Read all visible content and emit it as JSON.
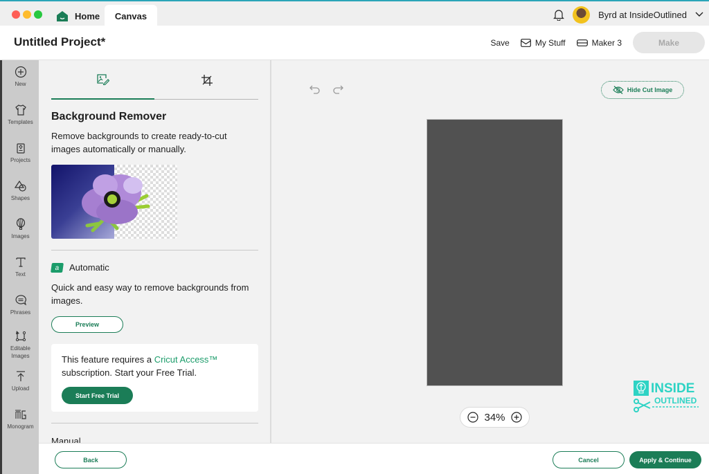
{
  "window": {
    "tabs": [
      {
        "label": "Home",
        "icon": "home-icon"
      },
      {
        "label": "Canvas",
        "active": true
      }
    ],
    "user": {
      "name": "Byrd at InsideOutlined",
      "avatar": "avatar",
      "notification_icon": "bell-icon"
    }
  },
  "header": {
    "project_title": "Untitled Project*",
    "save_label": "Save",
    "my_stuff_label": "My Stuff",
    "machine_label": "Maker 3",
    "make_label": "Make"
  },
  "sidebar": {
    "items": [
      {
        "label": "New",
        "icon": "plus-circle-icon"
      },
      {
        "label": "Templates",
        "icon": "shirt-icon"
      },
      {
        "label": "Projects",
        "icon": "projects-icon"
      },
      {
        "label": "Shapes",
        "icon": "shapes-icon"
      },
      {
        "label": "Images",
        "icon": "balloon-icon"
      },
      {
        "label": "Text",
        "icon": "text-icon"
      },
      {
        "label": "Phrases",
        "icon": "speech-bubble-icon"
      },
      {
        "label": "Editable Images",
        "icon": "editable-images-icon"
      },
      {
        "label": "Upload",
        "icon": "upload-icon"
      },
      {
        "label": "Monogram",
        "icon": "monogram-icon"
      }
    ]
  },
  "panel": {
    "tabs": [
      {
        "name": "background-remover",
        "icon": "image-edit-icon",
        "active": true
      },
      {
        "name": "crop",
        "icon": "crop-icon",
        "active": false
      }
    ],
    "title": "Background Remover",
    "description": "Remove backgrounds to create ready-to-cut images automatically or manually.",
    "automatic": {
      "label": "Automatic",
      "badge": "a",
      "description": "Quick and easy way to remove backgrounds from images.",
      "preview_label": "Preview"
    },
    "access": {
      "text_before": "This feature requires a ",
      "link": "Cricut Access™",
      "text_after": " subscription. Start your Free Trial.",
      "trial_label": "Start Free Trial"
    },
    "manual_label": "Manual"
  },
  "canvas": {
    "hide_cut_label": "Hide Cut Image",
    "zoom_level": "34%",
    "watermark": {
      "line1": "INSIDE",
      "line2": "OUTLINED"
    }
  },
  "footer": {
    "back_label": "Back",
    "cancel_label": "Cancel",
    "apply_label": "Apply & Continue"
  },
  "colors": {
    "brand_green": "#1b7d57",
    "accent_green": "#1b9c6a",
    "watermark_teal": "#2ed3c4",
    "mat_gray": "#515151"
  }
}
